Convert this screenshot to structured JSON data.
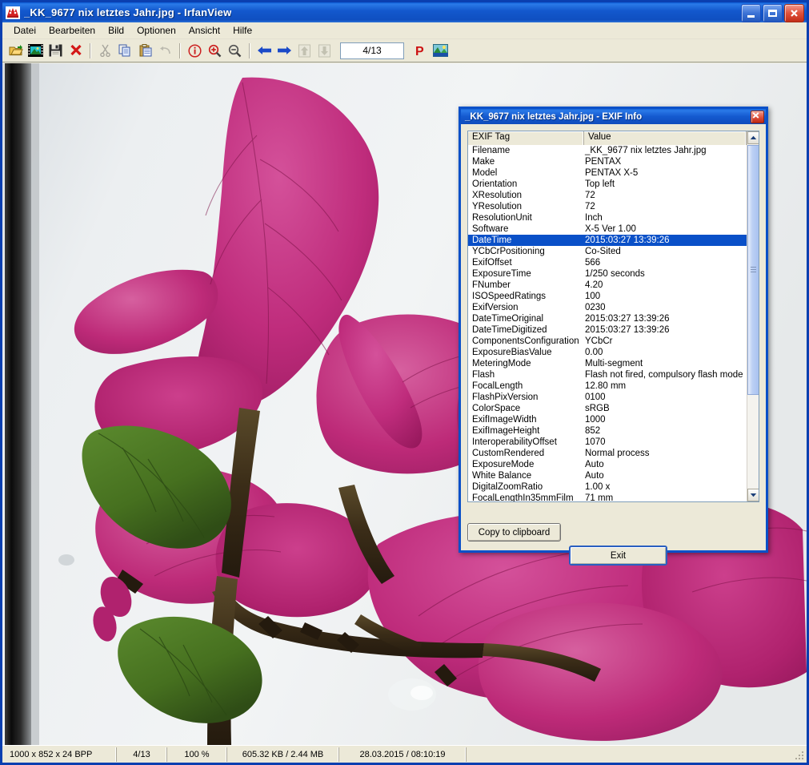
{
  "window": {
    "title": "_KK_9677 nix letztes Jahr.jpg - IrfanView",
    "icon": "irfanview-logo-icon",
    "buttons": {
      "minimize": "minimize-button",
      "maximize": "maximize-button",
      "close": "close-button"
    }
  },
  "menubar": {
    "items": [
      {
        "label": "Datei"
      },
      {
        "label": "Bearbeiten"
      },
      {
        "label": "Bild"
      },
      {
        "label": "Optionen"
      },
      {
        "label": "Ansicht"
      },
      {
        "label": "Hilfe"
      }
    ]
  },
  "toolbar": {
    "page_indicator": "4/13",
    "buttons": [
      {
        "name": "open-folder-icon",
        "title": "Open"
      },
      {
        "name": "thumbnails-icon",
        "title": "Thumbnails"
      },
      {
        "name": "save-icon",
        "title": "Save"
      },
      {
        "name": "delete-icon",
        "title": "Delete"
      },
      {
        "name": "cut-icon",
        "title": "Cut"
      },
      {
        "name": "copy-icon",
        "title": "Copy"
      },
      {
        "name": "paste-icon",
        "title": "Paste"
      },
      {
        "name": "undo-icon",
        "title": "Undo"
      },
      {
        "name": "info-icon",
        "title": "Information"
      },
      {
        "name": "zoom-in-icon",
        "title": "Zoom in"
      },
      {
        "name": "zoom-out-icon",
        "title": "Zoom out"
      },
      {
        "name": "previous-arrow-icon",
        "title": "Previous image"
      },
      {
        "name": "next-arrow-icon",
        "title": "Next image"
      },
      {
        "name": "first-image-icon",
        "title": "First image"
      },
      {
        "name": "last-image-icon",
        "title": "Last image"
      },
      {
        "name": "print-icon",
        "title": "Print"
      },
      {
        "name": "slideshow-icon",
        "title": "Slideshow"
      }
    ]
  },
  "statusbar": {
    "cells": [
      "1000 x 852 x 24 BPP",
      "4/13",
      "100 %",
      "605.32 KB / 2.44 MB",
      "28.03.2015 / 08:10:19"
    ]
  },
  "exif_dialog": {
    "title": "_KK_9677 nix letztes Jahr.jpg - EXIF Info",
    "close_label": "×",
    "columns": {
      "tag": "EXIF Tag",
      "value": "Value"
    },
    "selected_index": 8,
    "rows": [
      {
        "tag": "Filename",
        "value": "_KK_9677 nix letztes Jahr.jpg"
      },
      {
        "tag": "Make",
        "value": "PENTAX"
      },
      {
        "tag": "Model",
        "value": "PENTAX X-5"
      },
      {
        "tag": "Orientation",
        "value": "Top left"
      },
      {
        "tag": "XResolution",
        "value": "72"
      },
      {
        "tag": "YResolution",
        "value": "72"
      },
      {
        "tag": "ResolutionUnit",
        "value": "Inch"
      },
      {
        "tag": "Software",
        "value": "X-5 Ver 1.00"
      },
      {
        "tag": "DateTime",
        "value": "2015:03:27 13:39:26"
      },
      {
        "tag": "YCbCrPositioning",
        "value": "Co-Sited"
      },
      {
        "tag": "ExifOffset",
        "value": "566"
      },
      {
        "tag": "ExposureTime",
        "value": "1/250 seconds"
      },
      {
        "tag": "FNumber",
        "value": "4.20"
      },
      {
        "tag": "ISOSpeedRatings",
        "value": "100"
      },
      {
        "tag": "ExifVersion",
        "value": "0230"
      },
      {
        "tag": "DateTimeOriginal",
        "value": "2015:03:27 13:39:26"
      },
      {
        "tag": "DateTimeDigitized",
        "value": "2015:03:27 13:39:26"
      },
      {
        "tag": "ComponentsConfiguration",
        "value": "YCbCr"
      },
      {
        "tag": "ExposureBiasValue",
        "value": "0.00"
      },
      {
        "tag": "MeteringMode",
        "value": "Multi-segment"
      },
      {
        "tag": "Flash",
        "value": "Flash not fired, compulsory flash mode"
      },
      {
        "tag": "FocalLength",
        "value": "12.80 mm"
      },
      {
        "tag": "FlashPixVersion",
        "value": "0100"
      },
      {
        "tag": "ColorSpace",
        "value": "sRGB"
      },
      {
        "tag": "ExifImageWidth",
        "value": "1000"
      },
      {
        "tag": "ExifImageHeight",
        "value": "852"
      },
      {
        "tag": "InteroperabilityOffset",
        "value": "1070"
      },
      {
        "tag": "CustomRendered",
        "value": "Normal process"
      },
      {
        "tag": "ExposureMode",
        "value": "Auto"
      },
      {
        "tag": "White Balance",
        "value": "Auto"
      },
      {
        "tag": "DigitalZoomRatio",
        "value": "1.00 x"
      },
      {
        "tag": "FocalLengthIn35mmFilm",
        "value": "71 mm"
      }
    ],
    "copy_button": "Copy to clipboard",
    "exit_button": "Exit"
  },
  "photo": {
    "description": "Close-up photograph of magenta bougainvillea bracts with green leaves against a pale grey-white wall, dark vertical frame edge on the left",
    "colors": {
      "background_light": "#e7eaec",
      "bract_magenta": "#c0267a",
      "bract_deep": "#9c1a5e",
      "leaf_green": "#4f7a2a",
      "stem_dark": "#3a2a20",
      "edge_dark": "#141414"
    }
  },
  "theme": {
    "title_blue": "#0a50c8",
    "face": "#ece9d8",
    "selection_blue": "#0a50c8",
    "accent_red": "#cc2200"
  }
}
